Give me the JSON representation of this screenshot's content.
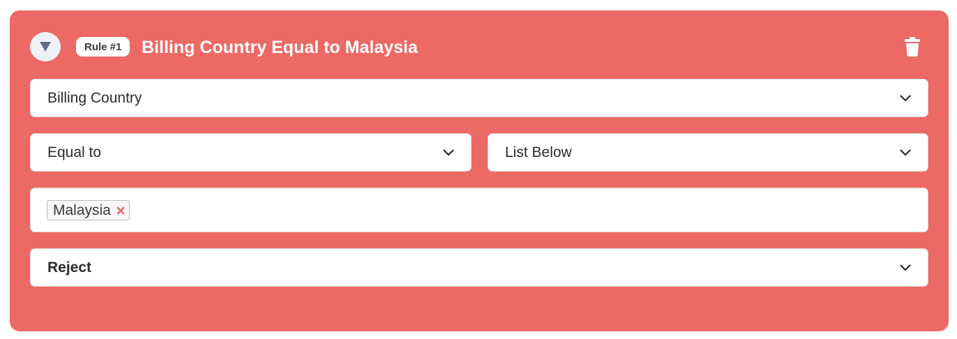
{
  "rule": {
    "badge": "Rule #1",
    "title": "Billing Country Equal to Malaysia",
    "field": {
      "value": "Billing Country"
    },
    "operator": {
      "value": "Equal to"
    },
    "value_source": {
      "value": "List Below"
    },
    "values": [
      {
        "label": "Malaysia"
      }
    ],
    "action": {
      "value": "Reject"
    }
  },
  "icons": {
    "collapse": "triangle-down-icon",
    "delete": "trash-icon",
    "dropdown": "chevron-down-icon",
    "remove_tag": "close-icon"
  },
  "colors": {
    "card_background": "#ec6965",
    "tag_remove": "#e8646b",
    "text_white": "#ffffff"
  }
}
